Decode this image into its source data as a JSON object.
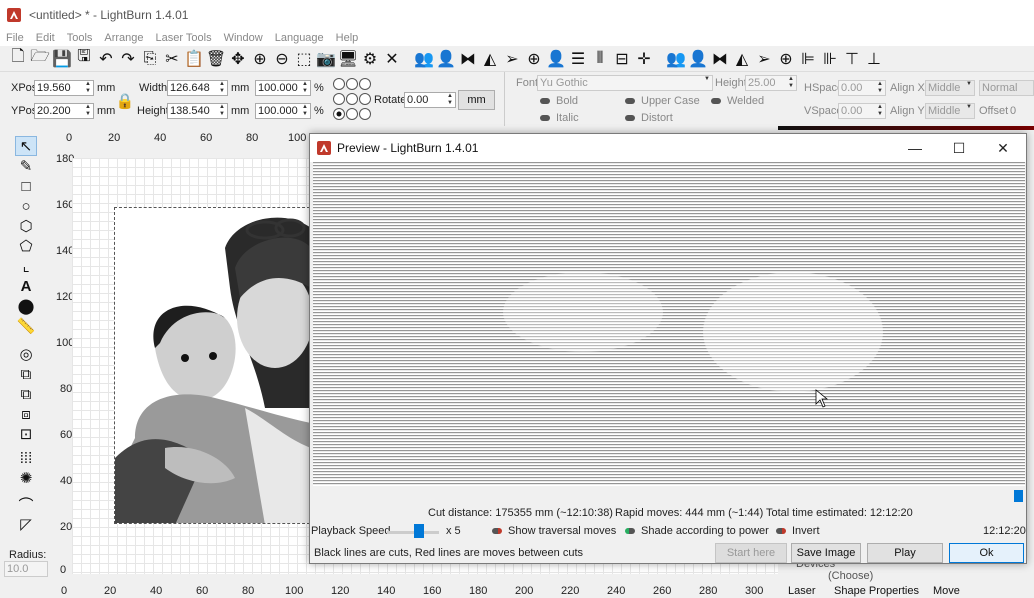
{
  "window": {
    "title": "<untitled> * - LightBurn 1.4.01"
  },
  "menu": [
    "File",
    "Edit",
    "Tools",
    "Arrange",
    "Laser Tools",
    "Window",
    "Language",
    "Help"
  ],
  "edit_toolbar": {
    "xpos_label": "XPos",
    "xpos_value": "19.560",
    "xpos_unit": "mm",
    "ypos_label": "YPos",
    "ypos_value": "20.200",
    "ypos_unit": "mm",
    "width_label": "Width",
    "width_value": "126.648",
    "width_unit": "mm",
    "height_label": "Height",
    "height_value": "138.540",
    "height_unit": "mm",
    "scale_w_value": "100.000",
    "scale_w_unit": "%",
    "scale_h_value": "100.000",
    "scale_h_unit": "%",
    "rotate_label": "Rotate",
    "rotate_value": "0.00",
    "units_button": "mm"
  },
  "font_toolbar": {
    "font_label": "Font",
    "font_value": "Yu Gothic",
    "height_label": "Height",
    "height_value": "25.00",
    "hspace_label": "HSpace",
    "hspace_value": "0.00",
    "vspace_label": "VSpace",
    "vspace_value": "0.00",
    "alignx_label": "Align X",
    "alignx_value": "Middle",
    "aligny_label": "Align Y",
    "aligny_value": "Middle",
    "style_value": "Normal",
    "offset_label": "Offset",
    "offset_value": "0",
    "bold": "Bold",
    "italic": "Italic",
    "upper_case": "Upper Case",
    "distort": "Distort",
    "welded": "Welded"
  },
  "rulers": {
    "top": [
      "0",
      "20",
      "40",
      "60",
      "80",
      "100"
    ],
    "bottom": [
      "0",
      "20",
      "40",
      "60",
      "80",
      "100",
      "120",
      "140",
      "160",
      "180",
      "200",
      "220",
      "240",
      "260",
      "280",
      "300"
    ],
    "left": [
      "180",
      "160",
      "140",
      "120",
      "100",
      "80",
      "60",
      "40",
      "20",
      "0"
    ]
  },
  "left_panel": {
    "radius_label": "Radius:",
    "radius_value": "10.0"
  },
  "preview": {
    "title": "Preview - LightBurn 1.4.01",
    "cut_distance": "Cut distance: 175355 mm (~12:10:38)",
    "rapid_moves": "Rapid moves: 444 mm (~1:44)",
    "total_time": "Total time estimated: 12:12:20",
    "playback_label": "Playback Speed",
    "playback_value": "x 5",
    "show_traversal": "Show traversal moves",
    "shade_power": "Shade according to power",
    "invert": "Invert",
    "elapsed": "12:12:20",
    "legend": "Black lines are cuts, Red lines are moves between cuts",
    "btn_start_here": "Start here",
    "btn_save_image": "Save Image",
    "btn_play": "Play",
    "btn_ok": "Ok",
    "playback_speed_fraction": 0.45,
    "progress_fraction": 1.0
  },
  "right_panel": {
    "devices_label": "Devices",
    "choose_label": "(Choose)"
  },
  "bottom_tabs": [
    "Laser",
    "Shape Properties",
    "Move"
  ],
  "colors": {
    "accent": "#0078d7",
    "toggle_red": "#c0392b",
    "toggle_green": "#27ae60",
    "laser_red": "#c0392b"
  }
}
